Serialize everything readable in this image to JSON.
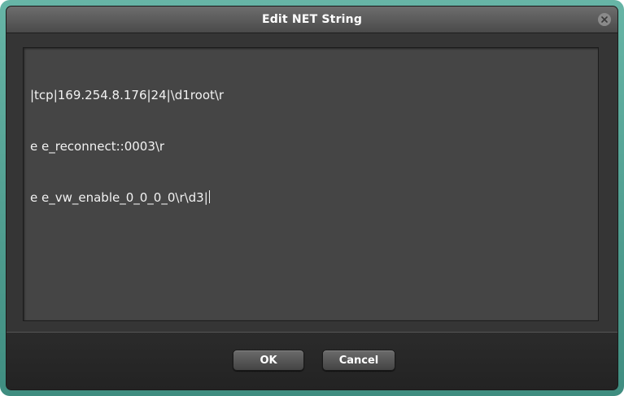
{
  "dialog": {
    "title": "Edit NET String",
    "close_icon": "close-icon"
  },
  "editor": {
    "lines": [
      "|tcp|169.254.8.176|24|\\d1root\\r",
      "e e_reconnect::0003\\r",
      "e e_vw_enable_0_0_0_0\\r\\d3|"
    ]
  },
  "buttons": {
    "ok_label": "OK",
    "cancel_label": "Cancel"
  },
  "colors": {
    "frame_accent": "#4fa394",
    "dialog_bg": "#353535",
    "editor_bg": "#454545",
    "text": "#f2f2f2"
  }
}
